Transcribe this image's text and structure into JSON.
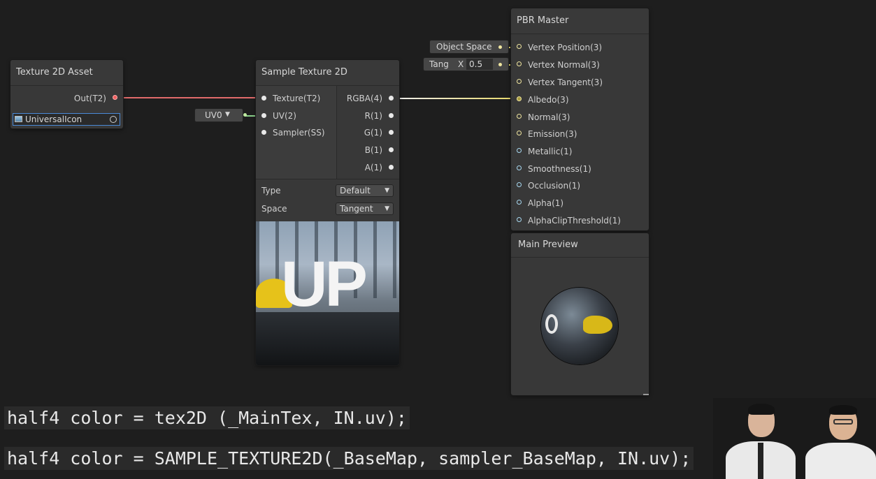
{
  "texture_asset_node": {
    "title": "Texture 2D Asset",
    "out_label": "Out(T2)",
    "asset_value": "UniversalIcon"
  },
  "sample_node": {
    "title": "Sample Texture 2D",
    "inputs": [
      "Texture(T2)",
      "UV(2)",
      "Sampler(SS)"
    ],
    "outputs": [
      "RGBA(4)",
      "R(1)",
      "G(1)",
      "B(1)",
      "A(1)"
    ],
    "type_label": "Type",
    "type_value": "Default",
    "space_label": "Space",
    "space_value": "Tangent",
    "preview_text": "UP"
  },
  "uv_pill": {
    "label": "UV0"
  },
  "object_space_pill": {
    "label": "Object Space"
  },
  "tangent_pill": {
    "label": "Tang",
    "x_label": "X",
    "x_value": "0.5"
  },
  "pbr_master": {
    "title": "PBR Master",
    "inputs": [
      "Vertex Position(3)",
      "Vertex Normal(3)",
      "Vertex Tangent(3)",
      "Albedo(3)",
      "Normal(3)",
      "Emission(3)",
      "Metallic(1)",
      "Smoothness(1)",
      "Occlusion(1)",
      "Alpha(1)",
      "AlphaClipThreshold(1)"
    ]
  },
  "main_preview": {
    "title": "Main Preview"
  },
  "code": {
    "line1": "half4 color = tex2D (_MainTex, IN.uv);",
    "line2": "half4 color = SAMPLE_TEXTURE2D(_BaseMap, sampler_BaseMap, IN.uv);"
  },
  "colors": {
    "background": "#1e1e1e",
    "node": "#383838",
    "texture_wire": "#e06060",
    "vector_wire": "#f0e6a0",
    "uv_wire": "#8ad08a"
  }
}
